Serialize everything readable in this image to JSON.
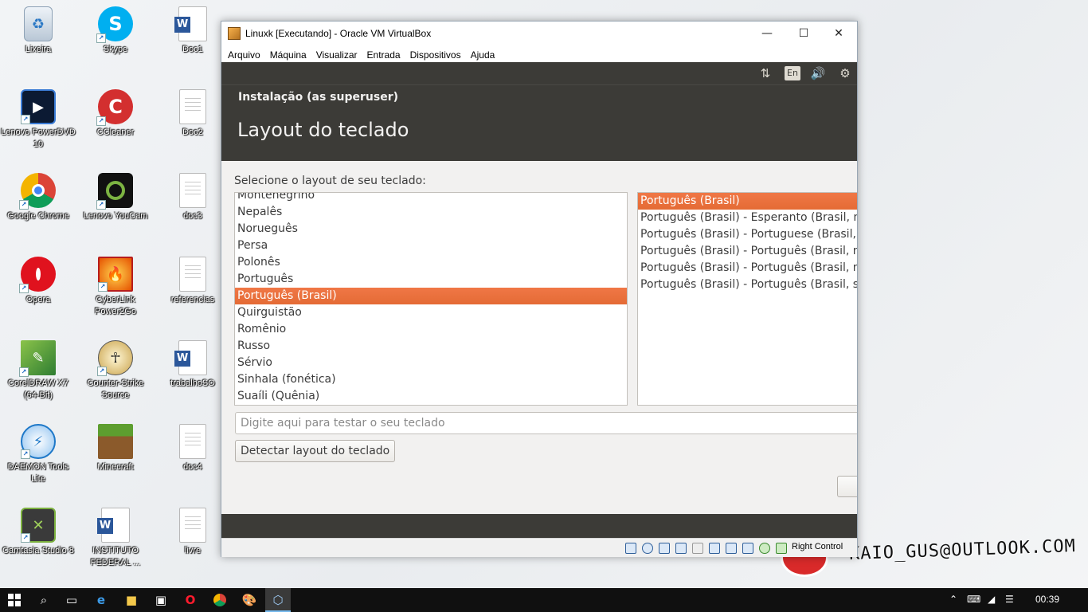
{
  "desktop": {
    "icons": [
      {
        "label": "Lixeira"
      },
      {
        "label": "Skype"
      },
      {
        "label": "Doc1"
      },
      {
        "label": "Lenovo PowerDVD 10"
      },
      {
        "label": "CCleaner"
      },
      {
        "label": "Doc2"
      },
      {
        "label": "Google Chrome"
      },
      {
        "label": "Lenovo YouCam"
      },
      {
        "label": "doc3"
      },
      {
        "label": "Opera"
      },
      {
        "label": "CyberLink Power2Go"
      },
      {
        "label": "referencias"
      },
      {
        "label": "CorelDRAW X7 (64-Bit)"
      },
      {
        "label": "Counter-Strike Source"
      },
      {
        "label": "trabalhoSO"
      },
      {
        "label": "DAEMON Tools Lite"
      },
      {
        "label": "Minecraft"
      },
      {
        "label": "doc4"
      },
      {
        "label": "Camtasia Studio 8"
      },
      {
        "label": "INSTITUTO FEDERAL ..."
      },
      {
        "label": "livre"
      }
    ],
    "watermark": "KAIO_GUS@OUTLOOK.COM"
  },
  "window": {
    "title": "Linuxk [Executando] - Oracle VM VirtualBox",
    "menu": [
      "Arquivo",
      "Máquina",
      "Visualizar",
      "Entrada",
      "Dispositivos",
      "Ajuda"
    ],
    "controls": {
      "minimize": "—",
      "maximize": "☐",
      "close": "✕"
    },
    "status_host_key": "Right Control"
  },
  "installer": {
    "panel": {
      "keyboard_indicator": "En",
      "network_icon": "⇅",
      "volume_icon": "🔊",
      "settings_icon": "⚙"
    },
    "header_small": "Instalação (as superuser)",
    "header_title": "Layout do teclado",
    "prompt": "Selecione o layout de seu teclado:",
    "layouts": [
      "Montenegrino",
      "Nepalês",
      "Norueguês",
      "Persa",
      "Polonês",
      "Português",
      "Português (Brasil)",
      "Quirguistão",
      "Romênio",
      "Russo",
      "Sérvio",
      "Sinhala (fonética)",
      "Suaíli (Quênia)"
    ],
    "selected_layout": "Português (Brasil)",
    "variants": [
      "Português (Brasil)",
      "Português (Brasil) - Esperanto (Brasil, na",
      "Português (Brasil) - Portuguese (Brasil, D",
      "Português (Brasil) - Português (Brasil, na",
      "Português (Brasil) - Português (Brasil, na",
      "Português (Brasil) - Português (Brasil, se"
    ],
    "selected_variant": "Português (Brasil)",
    "test_placeholder": "Digite aqui para testar o seu teclado",
    "detect_button": "Detectar layout do teclado"
  },
  "taskbar": {
    "clock": "00:39"
  }
}
